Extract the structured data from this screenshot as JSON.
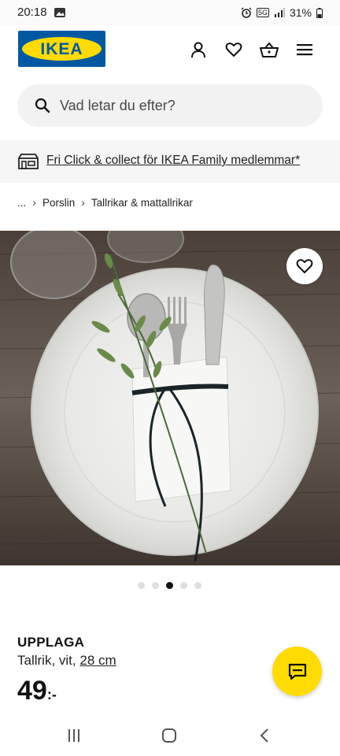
{
  "status_bar": {
    "time": "20:18",
    "battery": "31%",
    "network": "5G"
  },
  "header": {
    "logo_text": "IKEA",
    "icons": [
      "user-icon",
      "heart-icon",
      "basket-icon",
      "menu-icon"
    ]
  },
  "search": {
    "placeholder": "Vad letar du efter?"
  },
  "promo": {
    "text": "Fri Click & collect för IKEA Family medlemmar*"
  },
  "breadcrumb": {
    "ellipsis": "...",
    "items": [
      "Porslin",
      "Tallrikar & mattallrikar"
    ]
  },
  "gallery": {
    "dot_count": 5,
    "active_dot": 3
  },
  "product": {
    "name": "UPPLAGA",
    "description": "Tallrik, vit,",
    "size": "28 cm",
    "price_integer": "49",
    "price_suffix": ":-"
  },
  "colors": {
    "brand_blue": "#0058a3",
    "brand_yellow": "#ffdb00",
    "text": "#111111"
  }
}
